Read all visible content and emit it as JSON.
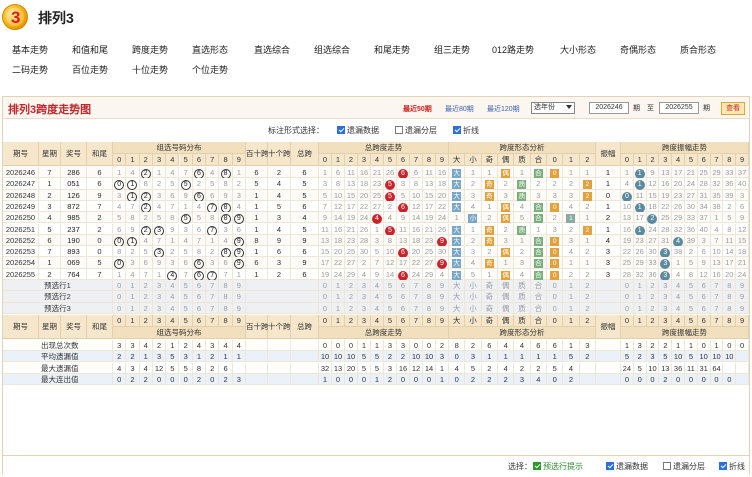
{
  "app": {
    "title": "排列3",
    "logo_number": "3"
  },
  "nav": {
    "row1": [
      "基本走势",
      "和值和尾",
      "跨度走势",
      "直选形态",
      "直选综合",
      "组选综合",
      "和尾走势",
      "组三走势",
      "012路走势",
      "大小形态",
      "奇偶形态",
      "质合形态"
    ],
    "row2": [
      "二码走势",
      "百位走势",
      "十位走势",
      "个位走势"
    ],
    "active": "跨度走势"
  },
  "panel": {
    "title": "排列3跨度走势图",
    "periods": [
      "最近50期",
      "最近80期",
      "最近120期"
    ],
    "active_period": "最近50期",
    "select_value": "选年份",
    "from_value": "2026246",
    "from_label": "期　至",
    "to_value": "2026255",
    "to_label": "期",
    "query_button": "查看"
  },
  "options": {
    "label": "标注形式选择：",
    "items": [
      {
        "label": "遗漏数据",
        "checked": true
      },
      {
        "label": "遗漏分层",
        "checked": false
      },
      {
        "label": "折线",
        "checked": true
      }
    ]
  },
  "table": {
    "headers": {
      "issue": "期号",
      "week": "星期",
      "award": "奖号",
      "sum_tail": "和尾",
      "g_zuxuan": "组选号码分布",
      "g_baishi": "百十跨",
      "g_shige": "十个跨",
      "g_total": "总跨",
      "g_zongkua": "总跨度走势",
      "g_kuaxing": "跨度形态分析",
      "g_zhenfu": "振幅",
      "g_zhenfu_trend": "跨度振幅走势",
      "digits": [
        "0",
        "1",
        "2",
        "3",
        "4",
        "5",
        "6",
        "7",
        "8",
        "9"
      ],
      "shape": [
        "大",
        "小",
        "奇",
        "偶",
        "质",
        "合",
        "0",
        "1",
        "2"
      ]
    },
    "rows": [
      {
        "issue": "2026246",
        "week": "7",
        "award": "286",
        "sum": "6",
        "bs": "6",
        "sg": "2",
        "total": "6",
        "zf": "1"
      },
      {
        "issue": "2026247",
        "week": "1",
        "award": "051",
        "sum": "6",
        "bs": "5",
        "sg": "4",
        "total": "5",
        "zf": "1"
      },
      {
        "issue": "2026248",
        "week": "2",
        "award": "126",
        "sum": "9",
        "bs": "1",
        "sg": "4",
        "total": "5",
        "zf": "0"
      },
      {
        "issue": "2026249",
        "week": "3",
        "award": "872",
        "sum": "7",
        "bs": "1",
        "sg": "5",
        "total": "6",
        "zf": "1"
      },
      {
        "issue": "2026250",
        "week": "4",
        "award": "985",
        "sum": "2",
        "bs": "1",
        "sg": "3",
        "total": "4",
        "zf": "2"
      },
      {
        "issue": "2026251",
        "week": "5",
        "award": "237",
        "sum": "2",
        "bs": "1",
        "sg": "4",
        "total": "5",
        "zf": "1"
      },
      {
        "issue": "2026252",
        "week": "6",
        "award": "190",
        "sum": "0",
        "bs": "8",
        "sg": "9",
        "total": "9",
        "zf": "4"
      },
      {
        "issue": "2026253",
        "week": "7",
        "award": "893",
        "sum": "0",
        "bs": "1",
        "sg": "6",
        "total": "6",
        "zf": "3"
      },
      {
        "issue": "2026254",
        "week": "1",
        "award": "069",
        "sum": "5",
        "bs": "6",
        "sg": "3",
        "total": "9",
        "zf": "3"
      },
      {
        "issue": "2026255",
        "week": "2",
        "award": "764",
        "week2": "",
        "sum": "7",
        "bs": "1",
        "sg": "2",
        "total": "6",
        "zf": "3"
      }
    ],
    "predict_rows": [
      "预选行1",
      "预选行2",
      "预选行3"
    ],
    "stats_rows": [
      "出现总次数",
      "平均遗漏值",
      "最大遗漏值",
      "最大连出值"
    ],
    "stats": {
      "出现总次数": [
        "3",
        "3",
        "4",
        "2",
        "1",
        "2",
        "4",
        "3",
        "4",
        "4",
        "",
        "",
        "",
        "0",
        "0",
        "0",
        "1",
        "1",
        "3",
        "3",
        "0",
        "0",
        "2",
        "8",
        "2",
        "6",
        "4",
        "4",
        "6",
        "6",
        "1",
        "3",
        "",
        "1",
        "3",
        "2",
        "2",
        "1",
        "1",
        "0",
        "1",
        "0",
        "0",
        "0"
      ],
      "平均遗漏值": [
        "2",
        "2",
        "1",
        "3",
        "5",
        "3",
        "1",
        "2",
        "1",
        "1",
        "",
        "",
        "",
        "10",
        "10",
        "10",
        "5",
        "5",
        "2",
        "2",
        "10",
        "10",
        "3",
        "0",
        "3",
        "1",
        "1",
        "1",
        "1",
        "1",
        "5",
        "2",
        "",
        "5",
        "2",
        "3",
        "5",
        "10",
        "5",
        "10",
        "10",
        "10"
      ],
      "最大遗漏值": [
        "4",
        "3",
        "4",
        "12",
        "5",
        "5",
        "8",
        "2",
        "6",
        "",
        "",
        "",
        "",
        "32",
        "13",
        "20",
        "5",
        "5",
        "3",
        "16",
        "12",
        "14",
        "1",
        "4",
        "5",
        "2",
        "4",
        "2",
        "2",
        "5",
        "4",
        "",
        "",
        "24",
        "5",
        "10",
        "13",
        "36",
        "11",
        "31",
        "64",
        ""
      ],
      "最大连出值": [
        "0",
        "2",
        "2",
        "0",
        "0",
        "0",
        "2",
        "0",
        "2",
        "3",
        "",
        "",
        "",
        "1",
        "0",
        "0",
        "0",
        "1",
        "2",
        "0",
        "0",
        "0",
        "1",
        "0",
        "2",
        "2",
        "2",
        "3",
        "4",
        "0",
        "2",
        "",
        "",
        "0",
        "0",
        "0",
        "2",
        "0",
        "0",
        "0",
        "0",
        "0"
      ]
    }
  },
  "footer": {
    "label": "选择：",
    "items": [
      {
        "label": "预选行提示",
        "checked": true,
        "green": true
      },
      {
        "label": "遗漏数据",
        "checked": true
      },
      {
        "label": "遗漏分层",
        "checked": false
      },
      {
        "label": "折线",
        "checked": true
      }
    ]
  }
}
